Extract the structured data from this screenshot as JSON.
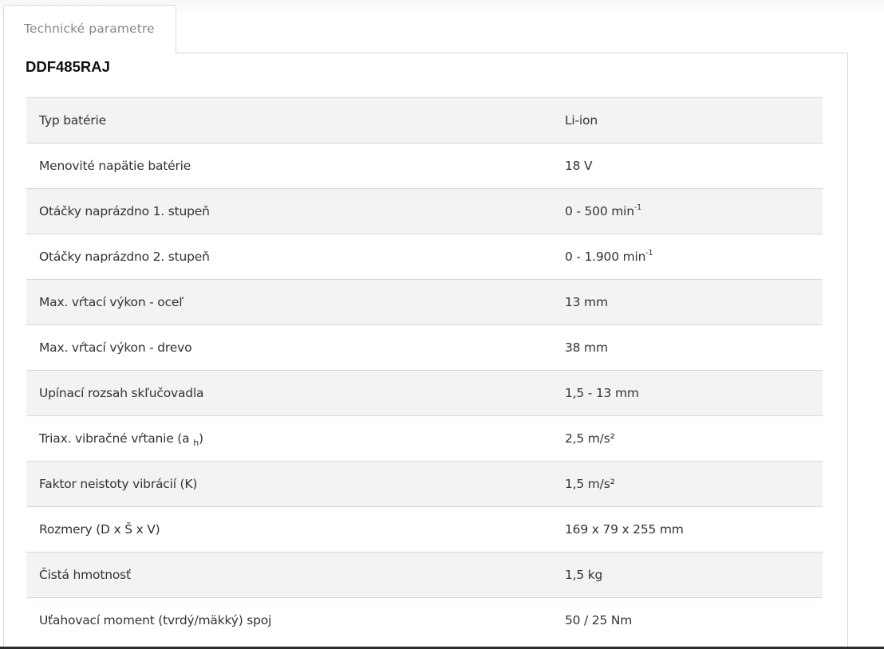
{
  "tabs": [
    {
      "label": "Technické parametre",
      "active": true
    }
  ],
  "product": {
    "model": "DDF485RAJ"
  },
  "specs": [
    {
      "label": "Typ batérie",
      "value": "Li-ion"
    },
    {
      "label": "Menovité napätie batérie",
      "value": "18 V"
    },
    {
      "label": "Otáčky naprázdno 1. stupeň",
      "value": "0 - 500 min",
      "value_sup": "-1"
    },
    {
      "label": "Otáčky naprázdno 2. stupeň",
      "value": "0 - 1.900 min",
      "value_sup": "-1"
    },
    {
      "label": "Max. vŕtací výkon - oceľ",
      "value": "13 mm"
    },
    {
      "label": "Max. vŕtací výkon - drevo",
      "value": "38 mm"
    },
    {
      "label": "Upínací rozsah skľučovadla",
      "value": "1,5 - 13 mm"
    },
    {
      "label": "Triax. vibračné vŕtanie (a",
      "label_sub": "h",
      "label_tail": ")",
      "value": "2,5 m/s²"
    },
    {
      "label": "Faktor neistoty vibrácií (K)",
      "value": "1,5 m/s²"
    },
    {
      "label": "Rozmery (D x Š x V)",
      "value": "169 x 79 x 255 mm"
    },
    {
      "label": "Čistá hmotnosť",
      "value": "1,5 kg"
    },
    {
      "label": "Uťahovací moment (tvrdý/mäkký) spoj",
      "value": "50 / 25 Nm"
    }
  ],
  "colors": {
    "border": "#c9dde3",
    "row_alt": "#f3f3f3",
    "text": "#333333",
    "tab_text": "#7f8a90"
  }
}
